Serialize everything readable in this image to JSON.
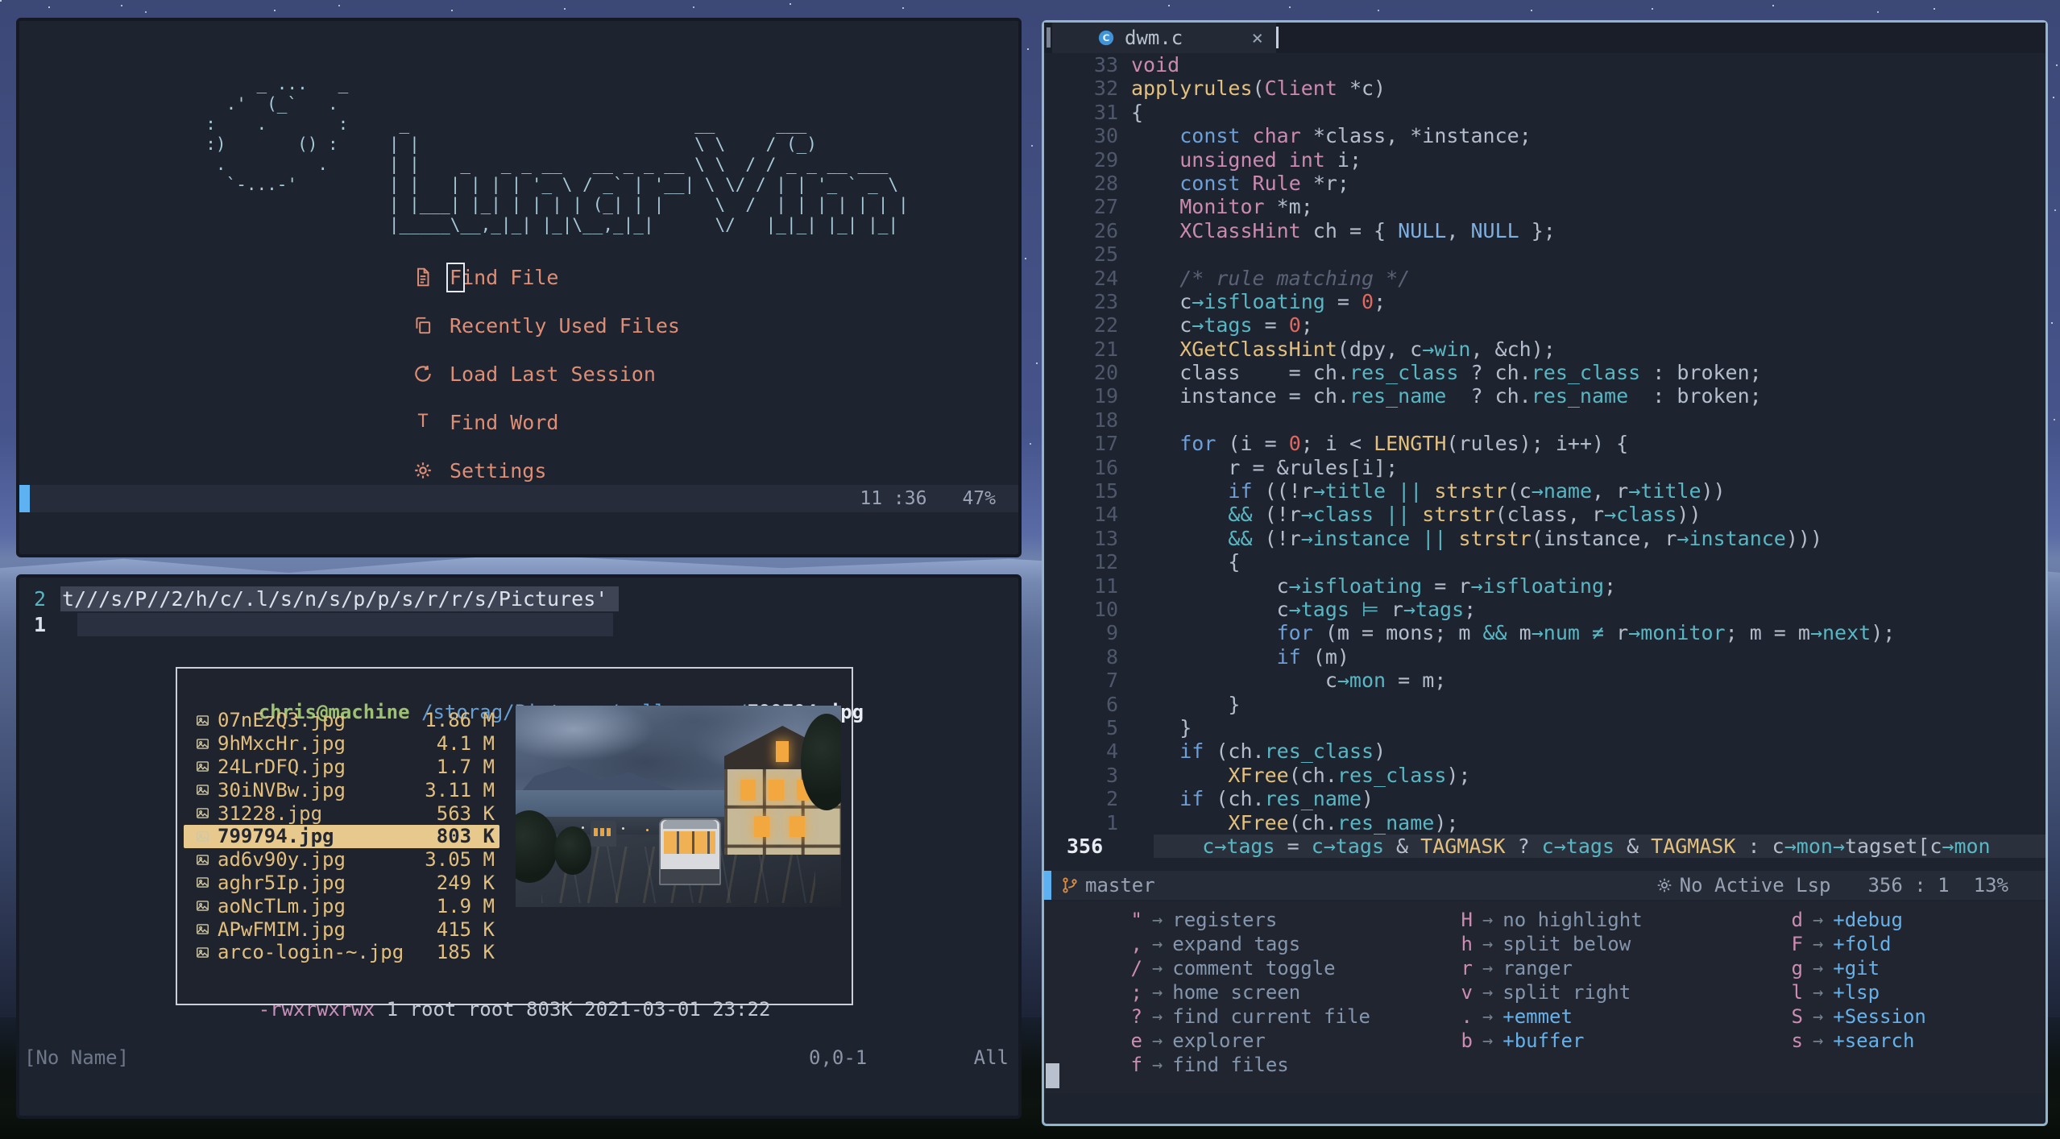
{
  "colors": {
    "editor_bg": "#1e2330",
    "focus_border_blue": "#92b4cd",
    "statusline_accent_blue": "#5fb2f2",
    "dashboard_salmon": "#de8e74",
    "logo_blue": "#a6cad8",
    "keyword_pink": "#cb8ab0",
    "keyword_blue": "#6d9fd8",
    "function_yellow": "#e3c07d",
    "member_teal": "#59b7c3",
    "number_red": "#e0695f",
    "null_blue": "#7fb0e0",
    "comment_gray": "#5a6375",
    "git_orange": "#d78d47",
    "selected_file_bg": "#e8c98d",
    "user_green": "#9cc170",
    "path_blue": "#64a0d8"
  },
  "dashboard": {
    "logo_lines": [
      "       _ ...   _",
      "    .'  (_`   .",
      "  :    .       :     _                            __      ___",
      "  :)       () :     | |                           \\ \\    / (_)",
      "   .         .      | |    _   _ _ __   __ _ _ __ \\ \\  / / _ _ __ ___",
      "    `-...-'         | |   | | | | '_ \\ / _` | '__| \\ \\/ / | | '_ ` _ \\",
      "                    | |___| |_| | | | | (_| | |     \\  /  | | | | | | |",
      "                    |_____\\__,_|_| |_|\\__,_|_|      \\/   |_|_| |_| |_|"
    ],
    "menu": [
      {
        "icon": "file-text-icon",
        "label": "Find File",
        "cursor_on_first_char": true
      },
      {
        "icon": "recent-files-icon",
        "label": "Recently Used Files"
      },
      {
        "icon": "session-icon",
        "label": "Load Last Session"
      },
      {
        "icon": "find-word-icon",
        "label": "Find Word"
      },
      {
        "icon": "settings-icon",
        "label": "Settings"
      }
    ],
    "statusline": {
      "position": "11 :36",
      "scroll": "47%"
    }
  },
  "scratch": {
    "lines": [
      {
        "num": "2",
        "text": "t///s/P//2/h/c/.l/s/n/s/p/p/s/r/r/s/Pictures'"
      },
      {
        "num": "1",
        "text": ""
      }
    ],
    "ranger": {
      "user": "chris@machine",
      "path": " /storag/Pictures/wallpapers/",
      "file": "799794.jpg",
      "files": [
        {
          "name": "07nEzQ3.jpg",
          "size": "1.86 M"
        },
        {
          "name": "9hMxcHr.jpg",
          "size": "4.1 M"
        },
        {
          "name": "24LrDFQ.jpg",
          "size": "1.7 M"
        },
        {
          "name": "30iNVBw.jpg",
          "size": "3.11 M"
        },
        {
          "name": "31228.jpg",
          "size": "563 K"
        },
        {
          "name": "799794.jpg",
          "size": "803 K",
          "selected": true
        },
        {
          "name": "ad6v90y.jpg",
          "size": "3.05 M"
        },
        {
          "name": "aghr5Ip.jpg",
          "size": "249 K"
        },
        {
          "name": "aoNcTLm.jpg",
          "size": "1.9 M"
        },
        {
          "name": "APwFMIM.jpg",
          "size": "415 K"
        },
        {
          "name": "arco-login-~.jpg",
          "size": "185 K"
        }
      ],
      "perms": "-rwxrwxrwx",
      "meta": " 1 root root 803K 2021-03-01 23:22"
    },
    "statusline": {
      "name": "[No Name]",
      "position": "0,0-1",
      "scroll": "All"
    }
  },
  "editor": {
    "tab": {
      "language": "c",
      "title": "dwm.c",
      "close": "×"
    },
    "code": [
      {
        "n": "33",
        "s": [
          [
            "k",
            "void"
          ]
        ]
      },
      {
        "n": "32",
        "s": [
          [
            "f",
            "applyrules"
          ],
          [
            "d",
            "("
          ],
          [
            "k",
            "Client"
          ],
          [
            "d",
            " *c)"
          ]
        ]
      },
      {
        "n": "31",
        "s": [
          [
            "d",
            "{"
          ]
        ]
      },
      {
        "n": "30",
        "s": [
          [
            "d",
            "    "
          ],
          [
            "b",
            "const"
          ],
          [
            "d",
            " "
          ],
          [
            "k",
            "char"
          ],
          [
            "d",
            " *class, *instance;"
          ]
        ]
      },
      {
        "n": "29",
        "s": [
          [
            "d",
            "    "
          ],
          [
            "k",
            "unsigned"
          ],
          [
            "d",
            " "
          ],
          [
            "k",
            "int"
          ],
          [
            "d",
            " i;"
          ]
        ]
      },
      {
        "n": "28",
        "s": [
          [
            "d",
            "    "
          ],
          [
            "b",
            "const"
          ],
          [
            "d",
            " "
          ],
          [
            "k",
            "Rule"
          ],
          [
            "d",
            " *r;"
          ]
        ]
      },
      {
        "n": "27",
        "s": [
          [
            "d",
            "    "
          ],
          [
            "k",
            "Monitor"
          ],
          [
            "d",
            " *m;"
          ]
        ]
      },
      {
        "n": "26",
        "s": [
          [
            "d",
            "    "
          ],
          [
            "k",
            "XClassHint"
          ],
          [
            "d",
            " ch = { "
          ],
          [
            "n2",
            "NULL"
          ],
          [
            "d",
            ", "
          ],
          [
            "n2",
            "NULL"
          ],
          [
            "d",
            " };"
          ]
        ]
      },
      {
        "n": "25",
        "s": []
      },
      {
        "n": "24",
        "s": [
          [
            "d",
            "    "
          ],
          [
            "c",
            "/* rule matching */"
          ]
        ]
      },
      {
        "n": "23",
        "s": [
          [
            "d",
            "    c"
          ],
          [
            "m",
            "→isfloating"
          ],
          [
            "d",
            " = "
          ],
          [
            "n",
            "0"
          ],
          [
            "d",
            ";"
          ]
        ]
      },
      {
        "n": "22",
        "s": [
          [
            "d",
            "    c"
          ],
          [
            "m",
            "→tags"
          ],
          [
            "d",
            " = "
          ],
          [
            "n",
            "0"
          ],
          [
            "d",
            ";"
          ]
        ]
      },
      {
        "n": "21",
        "s": [
          [
            "f",
            "    XGetClassHint"
          ],
          [
            "d",
            "(dpy, c"
          ],
          [
            "m",
            "→win"
          ],
          [
            "d",
            ", &ch);"
          ]
        ]
      },
      {
        "n": "20",
        "s": [
          [
            "d",
            "    class    = ch."
          ],
          [
            "m",
            "res_class"
          ],
          [
            "d",
            " ? ch."
          ],
          [
            "m",
            "res_class"
          ],
          [
            "d",
            " : broken;"
          ]
        ]
      },
      {
        "n": "19",
        "s": [
          [
            "d",
            "    instance = ch."
          ],
          [
            "m",
            "res_name"
          ],
          [
            "d",
            "  ? ch."
          ],
          [
            "m",
            "res_name"
          ],
          [
            "d",
            "  : broken;"
          ]
        ]
      },
      {
        "n": "18",
        "s": []
      },
      {
        "n": "17",
        "s": [
          [
            "d",
            "    "
          ],
          [
            "b",
            "for"
          ],
          [
            "d",
            " (i = "
          ],
          [
            "n",
            "0"
          ],
          [
            "d",
            "; i < "
          ],
          [
            "f",
            "LENGTH"
          ],
          [
            "d",
            "(rules); i++) {"
          ]
        ]
      },
      {
        "n": "16",
        "s": [
          [
            "d",
            "        r = &rules[i];"
          ]
        ]
      },
      {
        "n": "15",
        "s": [
          [
            "d",
            "        "
          ],
          [
            "b",
            "if"
          ],
          [
            "d",
            " ((!r"
          ],
          [
            "m",
            "→title"
          ],
          [
            "d",
            " "
          ],
          [
            "m",
            "||"
          ],
          [
            "d",
            " "
          ],
          [
            "f",
            "strstr"
          ],
          [
            "d",
            "(c"
          ],
          [
            "m",
            "→name"
          ],
          [
            "d",
            ", r"
          ],
          [
            "m",
            "→title"
          ],
          [
            "d",
            "))"
          ]
        ]
      },
      {
        "n": "14",
        "s": [
          [
            "d",
            "        "
          ],
          [
            "m",
            "&&"
          ],
          [
            "d",
            " (!r"
          ],
          [
            "m",
            "→class"
          ],
          [
            "d",
            " "
          ],
          [
            "m",
            "||"
          ],
          [
            "d",
            " "
          ],
          [
            "f",
            "strstr"
          ],
          [
            "d",
            "(class, r"
          ],
          [
            "m",
            "→class"
          ],
          [
            "d",
            "))"
          ]
        ]
      },
      {
        "n": "13",
        "s": [
          [
            "d",
            "        "
          ],
          [
            "m",
            "&&"
          ],
          [
            "d",
            " (!r"
          ],
          [
            "m",
            "→instance"
          ],
          [
            "d",
            " "
          ],
          [
            "m",
            "||"
          ],
          [
            "d",
            " "
          ],
          [
            "f",
            "strstr"
          ],
          [
            "d",
            "(instance, r"
          ],
          [
            "m",
            "→instance"
          ],
          [
            "d",
            ")))"
          ]
        ]
      },
      {
        "n": "12",
        "s": [
          [
            "d",
            "        {"
          ]
        ]
      },
      {
        "n": "11",
        "s": [
          [
            "d",
            "            c"
          ],
          [
            "m",
            "→isfloating"
          ],
          [
            "d",
            " = r"
          ],
          [
            "m",
            "→isfloating"
          ],
          [
            "d",
            ";"
          ]
        ]
      },
      {
        "n": "10",
        "s": [
          [
            "d",
            "            c"
          ],
          [
            "m",
            "→tags"
          ],
          [
            "d",
            " "
          ],
          [
            "m",
            "⊨"
          ],
          [
            "d",
            " r"
          ],
          [
            "m",
            "→tags"
          ],
          [
            "d",
            ";"
          ]
        ]
      },
      {
        "n": "9",
        "s": [
          [
            "d",
            "            "
          ],
          [
            "b",
            "for"
          ],
          [
            "d",
            " (m = mons; m "
          ],
          [
            "m",
            "&&"
          ],
          [
            "d",
            " m"
          ],
          [
            "m",
            "→num"
          ],
          [
            "d",
            " "
          ],
          [
            "m",
            "≠"
          ],
          [
            "d",
            " r"
          ],
          [
            "m",
            "→monitor"
          ],
          [
            "d",
            "; m = m"
          ],
          [
            "m",
            "→next"
          ],
          [
            "d",
            ");"
          ]
        ]
      },
      {
        "n": "8",
        "s": [
          [
            "d",
            "            "
          ],
          [
            "b",
            "if"
          ],
          [
            "d",
            " (m)"
          ]
        ]
      },
      {
        "n": "7",
        "s": [
          [
            "d",
            "                c"
          ],
          [
            "m",
            "→mon"
          ],
          [
            "d",
            " = m;"
          ]
        ]
      },
      {
        "n": "6",
        "s": [
          [
            "d",
            "        }"
          ]
        ]
      },
      {
        "n": "5",
        "s": [
          [
            "d",
            "    }"
          ]
        ]
      },
      {
        "n": "4",
        "s": [
          [
            "d",
            "    "
          ],
          [
            "b",
            "if"
          ],
          [
            "d",
            " (ch."
          ],
          [
            "m",
            "res_class"
          ],
          [
            "d",
            ")"
          ]
        ]
      },
      {
        "n": "3",
        "s": [
          [
            "d",
            "        "
          ],
          [
            "f",
            "XFree"
          ],
          [
            "d",
            "(ch."
          ],
          [
            "m",
            "res_class"
          ],
          [
            "d",
            ");"
          ]
        ]
      },
      {
        "n": "2",
        "s": [
          [
            "d",
            "    "
          ],
          [
            "b",
            "if"
          ],
          [
            "d",
            " (ch."
          ],
          [
            "m",
            "res_name"
          ],
          [
            "d",
            ")"
          ]
        ]
      },
      {
        "n": "1",
        "s": [
          [
            "d",
            "        "
          ],
          [
            "f",
            "XFree"
          ],
          [
            "d",
            "(ch."
          ],
          [
            "m",
            "res_name"
          ],
          [
            "d",
            ");"
          ]
        ]
      },
      {
        "n": "356",
        "cur": true,
        "s": [
          [
            "d",
            "    "
          ],
          [
            "m",
            "c→tags"
          ],
          [
            "d",
            " = "
          ],
          [
            "m",
            "c→tags"
          ],
          [
            "d",
            " & "
          ],
          [
            "f",
            "TAGMASK"
          ],
          [
            "d",
            " ? "
          ],
          [
            "m",
            "c→tags"
          ],
          [
            "d",
            " & "
          ],
          [
            "f",
            "TAGMASK"
          ],
          [
            "d",
            " : c"
          ],
          [
            "m",
            "→mon→"
          ],
          [
            "d",
            "tagset[c"
          ],
          [
            "m",
            "→mon"
          ]
        ]
      }
    ],
    "statusline": {
      "branch": "master",
      "lsp": "No Active Lsp",
      "position": "356 : 1",
      "scroll": "13%"
    },
    "whichkey": [
      [
        [
          "\"",
          "registers"
        ],
        [
          ",",
          "expand tags"
        ],
        [
          "/",
          "comment toggle"
        ],
        [
          ";",
          "home screen"
        ],
        [
          "?",
          "find current file"
        ],
        [
          "e",
          "explorer"
        ],
        [
          "f",
          "find files"
        ]
      ],
      [
        [
          "H",
          "no highlight"
        ],
        [
          "h",
          "split below"
        ],
        [
          "r",
          "ranger"
        ],
        [
          "v",
          "split right"
        ],
        [
          ".",
          "+emmet"
        ],
        [
          "b",
          "+buffer"
        ]
      ],
      [
        [
          "d",
          "+debug"
        ],
        [
          "F",
          "+fold"
        ],
        [
          "g",
          "+git"
        ],
        [
          "l",
          "+lsp"
        ],
        [
          "S",
          "+Session"
        ],
        [
          "s",
          "+search"
        ]
      ]
    ]
  }
}
